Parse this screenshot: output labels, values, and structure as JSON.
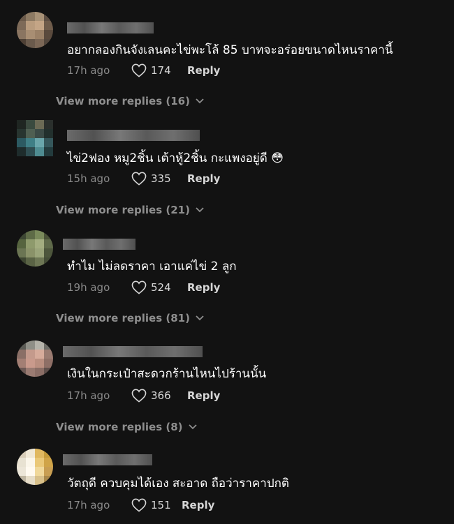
{
  "comments": [
    {
      "text": "อยากลองกินจังเลนคะไข่พะโล้ 85 บาทจะอร่อยขนาดไหนราคานี้",
      "time": "17h ago",
      "likes": "174",
      "reply_label": "Reply",
      "more_label": "View more replies (16)",
      "avatar_colors": [
        "#6b5a4a",
        "#8d7a63",
        "#a89277",
        "#5e4f43",
        "#7d6a58",
        "#b99c7e",
        "#c4a586",
        "#6f5c4b",
        "#8a7561",
        "#a88e73",
        "#9b8167",
        "#5a4a3d",
        "#4e4035",
        "#6a5a4c",
        "#7c6857",
        "#53473d"
      ]
    },
    {
      "text": "ไข่2ฟอง หมู2ชิ้น เต้าหู้2ชิ้น กะแพงอยู่ดี 😳",
      "time": "15h ago",
      "likes": "335",
      "reply_label": "Reply",
      "more_label": "View more replies (21)",
      "avatar_colors": [
        "#1f2622",
        "#3a4a3f",
        "#6b6a55",
        "#2a2f2c",
        "#283530",
        "#4f5f52",
        "#3b4a46",
        "#22302d",
        "#2c5a62",
        "#3f7f86",
        "#6aa6ab",
        "#35575b",
        "#1e2c2c",
        "#2f4e52",
        "#4f8c91",
        "#233b3d"
      ]
    },
    {
      "text": "ทำไม ไม่ลดราคา เอาแค่ไข่ 2 ลูก",
      "time": "19h ago",
      "likes": "524",
      "reply_label": "Reply",
      "more_label": "View more replies (81)",
      "avatar_colors": [
        "#3d4733",
        "#5e6b47",
        "#7a8a5b",
        "#4a5238",
        "#56643f",
        "#8e9a6c",
        "#a3ad80",
        "#5f6a4a",
        "#6b7553",
        "#8a9269",
        "#9aa47a",
        "#4d563c",
        "#3e4631",
        "#5a6345",
        "#6e7755",
        "#454d37"
      ]
    },
    {
      "text": "เงินในกระเป๋าสะดวกร้านไหนไปร้านนั้น",
      "time": "17h ago",
      "likes": "366",
      "reply_label": "Reply",
      "more_label": "View more replies (8)",
      "avatar_colors": [
        "#5b5b55",
        "#8f8f87",
        "#b5b3aa",
        "#6d6c66",
        "#8a6f66",
        "#c49a8c",
        "#d6ab9b",
        "#9a7b71",
        "#a37f74",
        "#c99a8c",
        "#ba8f80",
        "#8e6f66",
        "#6d5a55",
        "#9a7b72",
        "#8b6e66",
        "#5f4f4b"
      ]
    },
    {
      "text": "วัตถุดี ควบคุมได้เอง สะอาด ถือว่าราคาปกติ",
      "time": "17h ago",
      "likes": "151",
      "reply_label": "Reply",
      "more_label": "",
      "avatar_colors": [
        "#d8cdb8",
        "#f0e8d6",
        "#e0b860",
        "#c49a3a",
        "#e8e2d2",
        "#fbf6ea",
        "#eac878",
        "#d0a448",
        "#ece6d8",
        "#fffaf0",
        "#f0d89a",
        "#c89e52",
        "#bfb6a2",
        "#e6ddc8",
        "#d8c08a",
        "#a8884a"
      ]
    }
  ]
}
